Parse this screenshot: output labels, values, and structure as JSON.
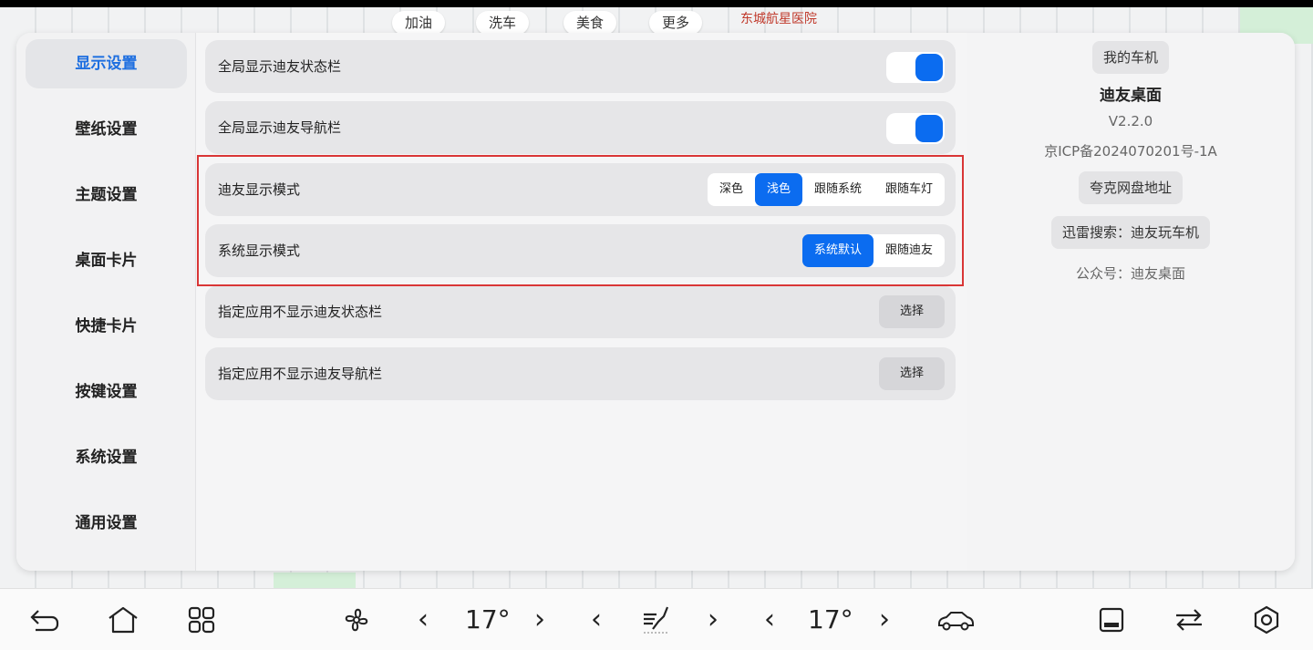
{
  "map": {
    "chips": [
      "加油",
      "洗车",
      "美食",
      "更多"
    ],
    "labels": [
      "东城航星医院"
    ]
  },
  "sidebar": {
    "items": [
      {
        "label": "显示设置",
        "active": true
      },
      {
        "label": "壁纸设置"
      },
      {
        "label": "主题设置"
      },
      {
        "label": "桌面卡片"
      },
      {
        "label": "快捷卡片"
      },
      {
        "label": "按键设置"
      },
      {
        "label": "系统设置"
      },
      {
        "label": "通用设置"
      }
    ]
  },
  "settings": {
    "status_bar": {
      "label": "全局显示迪友状态栏",
      "enabled": true
    },
    "nav_bar": {
      "label": "全局显示迪友导航栏",
      "enabled": true
    },
    "display_mode": {
      "label": "迪友显示模式",
      "options": [
        "深色",
        "浅色",
        "跟随系统",
        "跟随车灯"
      ],
      "selected": "浅色"
    },
    "system_display_mode": {
      "label": "系统显示模式",
      "options": [
        "系统默认",
        "跟随迪友"
      ],
      "selected": "系统默认"
    },
    "hide_status_apps": {
      "label": "指定应用不显示迪友状态栏",
      "button": "选择"
    },
    "hide_nav_apps": {
      "label": "指定应用不显示迪友导航栏",
      "button": "选择"
    }
  },
  "info": {
    "my_car_button": "我的车机",
    "app_name": "迪友桌面",
    "version": "V2.2.0",
    "icp": "京ICP备2024070201号-1A",
    "quark_button": "夸克网盘地址",
    "xunlei_button": "迅雷搜索：迪友玩车机",
    "wechat": "公众号：迪友桌面"
  },
  "bottom_bar": {
    "left_temp": "17°",
    "right_temp": "17°",
    "icons": [
      "back-icon",
      "home-icon",
      "apps-grid-icon",
      "fan-icon",
      "seat-heat-icon",
      "car-icon",
      "window-icon",
      "switch-icon",
      "settings-icon"
    ]
  }
}
